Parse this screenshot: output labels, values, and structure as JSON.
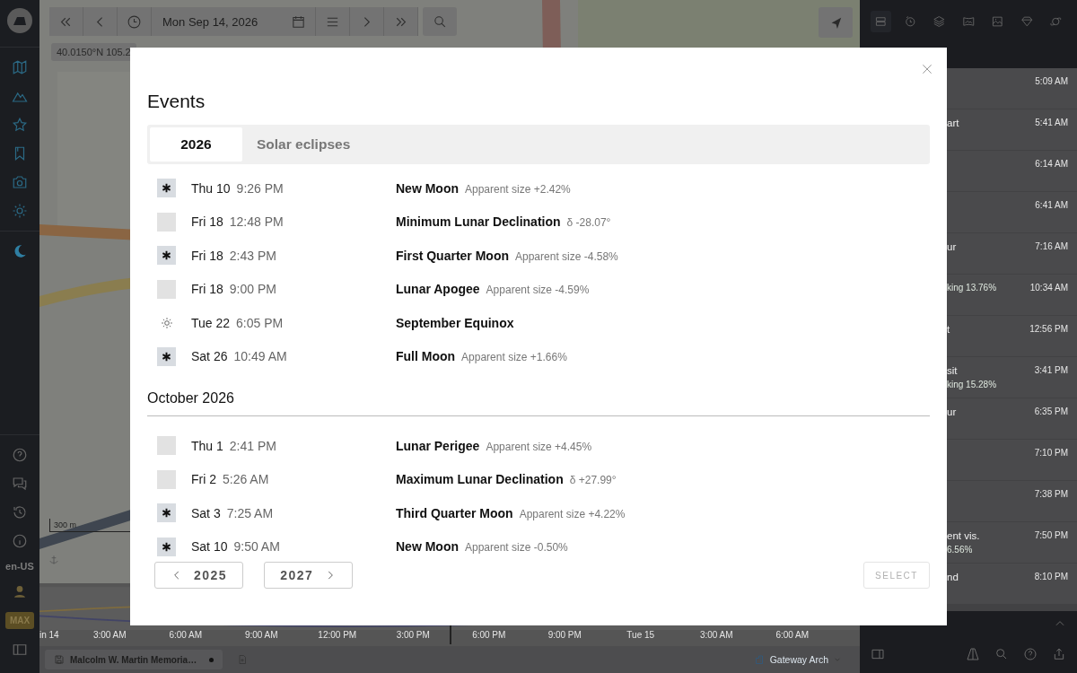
{
  "toolbar": {
    "date": "Mon Sep 14, 2026"
  },
  "map": {
    "coordinates": "40.0150°N 105.2",
    "scale": "300 m"
  },
  "sidebar": {
    "locale": "en-US",
    "badge": "MAX"
  },
  "timeline": {
    "labels": [
      "in 14",
      "3:00 AM",
      "6:00 AM",
      "9:00 AM",
      "12:00 PM",
      "3:00 PM",
      "6:00 PM",
      "9:00 PM",
      "Tue 15",
      "3:00 AM",
      "6:00 AM"
    ]
  },
  "bottom_bar": {
    "location_tab": "Malcolm W. Martin Memoria…",
    "unsaved": true,
    "place": "Gateway Arch"
  },
  "right_panel": {
    "rows": [
      {
        "time": "5:09 AM"
      },
      {
        "title": "art",
        "time": "5:41 AM"
      },
      {
        "time": "6:14 AM"
      },
      {
        "time": "6:41 AM"
      },
      {
        "title": "ur",
        "time": "7:16 AM"
      },
      {
        "detail": "king 13.76%",
        "time": "10:34 AM"
      },
      {
        "title": "t",
        "time": "12:56 PM"
      },
      {
        "title": "sit",
        "detail": "king 15.28%",
        "time": "3:41 PM"
      },
      {
        "title": "ur",
        "time": "6:35 PM"
      },
      {
        "time": "7:10 PM"
      },
      {
        "time": "7:38 PM"
      },
      {
        "title": "ent vis.",
        "detail": "6.56%",
        "time": "7:50 PM"
      },
      {
        "title": "nd",
        "time": "8:10 PM"
      }
    ]
  },
  "modal": {
    "title": "Events",
    "tabs": [
      {
        "label": "2026",
        "selected": true
      },
      {
        "label": "Solar eclipses",
        "selected": false
      }
    ],
    "sections": [
      {
        "events": [
          {
            "kind": "phase",
            "day": "Thu 10",
            "time": "9:26 PM",
            "name": "New Moon",
            "detail": "Apparent size +2.42%"
          },
          {
            "kind": "lunar",
            "day": "Fri 18",
            "time": "12:48 PM",
            "name": "Minimum Lunar Declination",
            "detail": "δ -28.07°"
          },
          {
            "kind": "phase",
            "day": "Fri 18",
            "time": "2:43 PM",
            "name": "First Quarter Moon",
            "detail": "Apparent size -4.58%"
          },
          {
            "kind": "lunar",
            "day": "Fri 18",
            "time": "9:00 PM",
            "name": "Lunar Apogee",
            "detail": "Apparent size -4.59%"
          },
          {
            "kind": "solar",
            "day": "Tue 22",
            "time": "6:05 PM",
            "name": "September Equinox"
          },
          {
            "kind": "phase",
            "day": "Sat 26",
            "time": "10:49 AM",
            "name": "Full Moon",
            "detail": "Apparent size +1.66%"
          }
        ]
      },
      {
        "heading": "October 2026",
        "events": [
          {
            "kind": "lunar",
            "day": "Thu 1",
            "time": "2:41 PM",
            "name": "Lunar Perigee",
            "detail": "Apparent size +4.45%"
          },
          {
            "kind": "lunar",
            "day": "Fri 2",
            "time": "5:26 AM",
            "name": "Maximum Lunar Declination",
            "detail": "δ +27.99°"
          },
          {
            "kind": "phase",
            "day": "Sat 3",
            "time": "7:25 AM",
            "name": "Third Quarter Moon",
            "detail": "Apparent size +4.22%"
          },
          {
            "kind": "phase",
            "day": "Sat 10",
            "time": "9:50 AM",
            "name": "New Moon",
            "detail": "Apparent size -0.50%"
          }
        ]
      }
    ],
    "prev_year": "2025",
    "next_year": "2027",
    "select_button": {
      "label": "SELECT",
      "disabled": true
    }
  }
}
